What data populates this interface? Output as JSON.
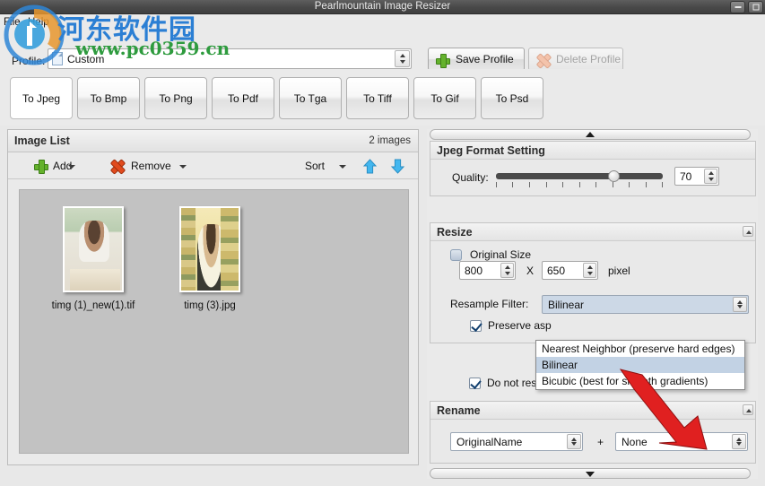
{
  "window": {
    "title": "Pearlmountain Image Resizer",
    "minimize_icon": "minimize-icon",
    "maximize_icon": "maximize-icon"
  },
  "menubar": {
    "items": [
      {
        "label": "File"
      },
      {
        "label": "Help"
      }
    ]
  },
  "profile": {
    "label": "Profile:",
    "value": "Custom",
    "icon": "document-icon",
    "save_label": "Save Profile",
    "delete_label": "Delete Profile",
    "delete_enabled": false
  },
  "format_buttons": [
    {
      "label": "To Jpeg",
      "selected": true
    },
    {
      "label": "To Bmp",
      "selected": false
    },
    {
      "label": "To Png",
      "selected": false
    },
    {
      "label": "To Pdf",
      "selected": false
    },
    {
      "label": "To Tga",
      "selected": false
    },
    {
      "label": "To Tiff",
      "selected": false
    },
    {
      "label": "To Gif",
      "selected": false
    },
    {
      "label": "To Psd",
      "selected": false
    }
  ],
  "image_list": {
    "title": "Image List",
    "count_label": "2 images",
    "toolbar": {
      "add_label": "Add",
      "remove_label": "Remove",
      "sort_label": "Sort",
      "move_up_icon": "arrow-up-icon",
      "move_down_icon": "arrow-down-icon"
    },
    "thumbnails": [
      {
        "name": "timg (1)_new(1).tif"
      },
      {
        "name": "timg (3).jpg"
      }
    ]
  },
  "right_panel": {
    "scroll_up_icon": "chevron-up-icon",
    "scroll_down_icon": "chevron-down-icon",
    "jpeg": {
      "title": "Jpeg Format Setting",
      "quality_label": "Quality:",
      "quality_value": "70",
      "slider_min": 0,
      "slider_max": 100,
      "slider_ticks": 11
    },
    "resize": {
      "title": "Resize",
      "original_size_label": "Original Size",
      "original_size_checked": false,
      "width": "800",
      "separator": "X",
      "height": "650",
      "unit_label": "pixel",
      "resample_label": "Resample Filter:",
      "resample_value": "Bilinear",
      "resample_options": [
        "Nearest Neighbor (preserve hard edges)",
        "Bilinear",
        "Bicubic (best for smooth gradients)"
      ],
      "resample_selected_index": 1,
      "preserve_aspect_label": "Preserve asp",
      "preserve_aspect_checked": true,
      "do_not_resize_label": "Do not resize",
      "do_not_resize_checked": true
    },
    "rename": {
      "title": "Rename",
      "base_value": "OriginalName",
      "plus_label": "+",
      "suffix_value": "None"
    }
  },
  "watermark": {
    "site_name": "河东软件园",
    "url": "www.pc0359.cn",
    "site_color": "#2b7fd4",
    "url_color": "#2e9b3e"
  },
  "annotation": {
    "arrow_color": "#e02020",
    "arrow_icon": "red-pointer-arrow"
  }
}
